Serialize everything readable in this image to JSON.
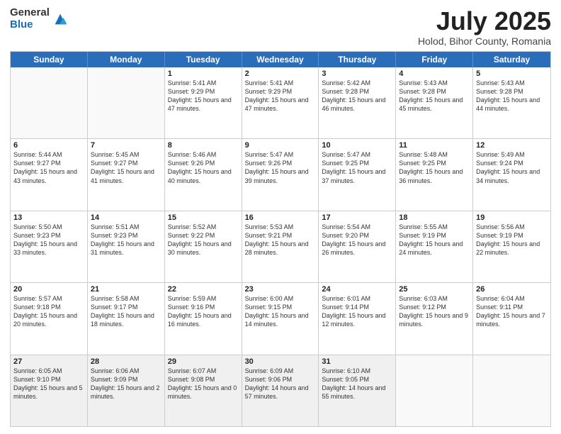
{
  "logo": {
    "general": "General",
    "blue": "Blue"
  },
  "title": "July 2025",
  "location": "Holod, Bihor County, Romania",
  "days_of_week": [
    "Sunday",
    "Monday",
    "Tuesday",
    "Wednesday",
    "Thursday",
    "Friday",
    "Saturday"
  ],
  "weeks": [
    [
      {
        "day": "",
        "sunrise": "",
        "sunset": "",
        "daylight": "",
        "empty": true
      },
      {
        "day": "",
        "sunrise": "",
        "sunset": "",
        "daylight": "",
        "empty": true
      },
      {
        "day": "1",
        "sunrise": "Sunrise: 5:41 AM",
        "sunset": "Sunset: 9:29 PM",
        "daylight": "Daylight: 15 hours and 47 minutes."
      },
      {
        "day": "2",
        "sunrise": "Sunrise: 5:41 AM",
        "sunset": "Sunset: 9:29 PM",
        "daylight": "Daylight: 15 hours and 47 minutes."
      },
      {
        "day": "3",
        "sunrise": "Sunrise: 5:42 AM",
        "sunset": "Sunset: 9:28 PM",
        "daylight": "Daylight: 15 hours and 46 minutes."
      },
      {
        "day": "4",
        "sunrise": "Sunrise: 5:43 AM",
        "sunset": "Sunset: 9:28 PM",
        "daylight": "Daylight: 15 hours and 45 minutes."
      },
      {
        "day": "5",
        "sunrise": "Sunrise: 5:43 AM",
        "sunset": "Sunset: 9:28 PM",
        "daylight": "Daylight: 15 hours and 44 minutes."
      }
    ],
    [
      {
        "day": "6",
        "sunrise": "Sunrise: 5:44 AM",
        "sunset": "Sunset: 9:27 PM",
        "daylight": "Daylight: 15 hours and 43 minutes."
      },
      {
        "day": "7",
        "sunrise": "Sunrise: 5:45 AM",
        "sunset": "Sunset: 9:27 PM",
        "daylight": "Daylight: 15 hours and 41 minutes."
      },
      {
        "day": "8",
        "sunrise": "Sunrise: 5:46 AM",
        "sunset": "Sunset: 9:26 PM",
        "daylight": "Daylight: 15 hours and 40 minutes."
      },
      {
        "day": "9",
        "sunrise": "Sunrise: 5:47 AM",
        "sunset": "Sunset: 9:26 PM",
        "daylight": "Daylight: 15 hours and 39 minutes."
      },
      {
        "day": "10",
        "sunrise": "Sunrise: 5:47 AM",
        "sunset": "Sunset: 9:25 PM",
        "daylight": "Daylight: 15 hours and 37 minutes."
      },
      {
        "day": "11",
        "sunrise": "Sunrise: 5:48 AM",
        "sunset": "Sunset: 9:25 PM",
        "daylight": "Daylight: 15 hours and 36 minutes."
      },
      {
        "day": "12",
        "sunrise": "Sunrise: 5:49 AM",
        "sunset": "Sunset: 9:24 PM",
        "daylight": "Daylight: 15 hours and 34 minutes."
      }
    ],
    [
      {
        "day": "13",
        "sunrise": "Sunrise: 5:50 AM",
        "sunset": "Sunset: 9:23 PM",
        "daylight": "Daylight: 15 hours and 33 minutes."
      },
      {
        "day": "14",
        "sunrise": "Sunrise: 5:51 AM",
        "sunset": "Sunset: 9:23 PM",
        "daylight": "Daylight: 15 hours and 31 minutes."
      },
      {
        "day": "15",
        "sunrise": "Sunrise: 5:52 AM",
        "sunset": "Sunset: 9:22 PM",
        "daylight": "Daylight: 15 hours and 30 minutes."
      },
      {
        "day": "16",
        "sunrise": "Sunrise: 5:53 AM",
        "sunset": "Sunset: 9:21 PM",
        "daylight": "Daylight: 15 hours and 28 minutes."
      },
      {
        "day": "17",
        "sunrise": "Sunrise: 5:54 AM",
        "sunset": "Sunset: 9:20 PM",
        "daylight": "Daylight: 15 hours and 26 minutes."
      },
      {
        "day": "18",
        "sunrise": "Sunrise: 5:55 AM",
        "sunset": "Sunset: 9:19 PM",
        "daylight": "Daylight: 15 hours and 24 minutes."
      },
      {
        "day": "19",
        "sunrise": "Sunrise: 5:56 AM",
        "sunset": "Sunset: 9:19 PM",
        "daylight": "Daylight: 15 hours and 22 minutes."
      }
    ],
    [
      {
        "day": "20",
        "sunrise": "Sunrise: 5:57 AM",
        "sunset": "Sunset: 9:18 PM",
        "daylight": "Daylight: 15 hours and 20 minutes."
      },
      {
        "day": "21",
        "sunrise": "Sunrise: 5:58 AM",
        "sunset": "Sunset: 9:17 PM",
        "daylight": "Daylight: 15 hours and 18 minutes."
      },
      {
        "day": "22",
        "sunrise": "Sunrise: 5:59 AM",
        "sunset": "Sunset: 9:16 PM",
        "daylight": "Daylight: 15 hours and 16 minutes."
      },
      {
        "day": "23",
        "sunrise": "Sunrise: 6:00 AM",
        "sunset": "Sunset: 9:15 PM",
        "daylight": "Daylight: 15 hours and 14 minutes."
      },
      {
        "day": "24",
        "sunrise": "Sunrise: 6:01 AM",
        "sunset": "Sunset: 9:14 PM",
        "daylight": "Daylight: 15 hours and 12 minutes."
      },
      {
        "day": "25",
        "sunrise": "Sunrise: 6:03 AM",
        "sunset": "Sunset: 9:12 PM",
        "daylight": "Daylight: 15 hours and 9 minutes."
      },
      {
        "day": "26",
        "sunrise": "Sunrise: 6:04 AM",
        "sunset": "Sunset: 9:11 PM",
        "daylight": "Daylight: 15 hours and 7 minutes."
      }
    ],
    [
      {
        "day": "27",
        "sunrise": "Sunrise: 6:05 AM",
        "sunset": "Sunset: 9:10 PM",
        "daylight": "Daylight: 15 hours and 5 minutes."
      },
      {
        "day": "28",
        "sunrise": "Sunrise: 6:06 AM",
        "sunset": "Sunset: 9:09 PM",
        "daylight": "Daylight: 15 hours and 2 minutes."
      },
      {
        "day": "29",
        "sunrise": "Sunrise: 6:07 AM",
        "sunset": "Sunset: 9:08 PM",
        "daylight": "Daylight: 15 hours and 0 minutes."
      },
      {
        "day": "30",
        "sunrise": "Sunrise: 6:09 AM",
        "sunset": "Sunset: 9:06 PM",
        "daylight": "Daylight: 14 hours and 57 minutes."
      },
      {
        "day": "31",
        "sunrise": "Sunrise: 6:10 AM",
        "sunset": "Sunset: 9:05 PM",
        "daylight": "Daylight: 14 hours and 55 minutes."
      },
      {
        "day": "",
        "sunrise": "",
        "sunset": "",
        "daylight": "",
        "empty": true
      },
      {
        "day": "",
        "sunrise": "",
        "sunset": "",
        "daylight": "",
        "empty": true
      }
    ]
  ]
}
